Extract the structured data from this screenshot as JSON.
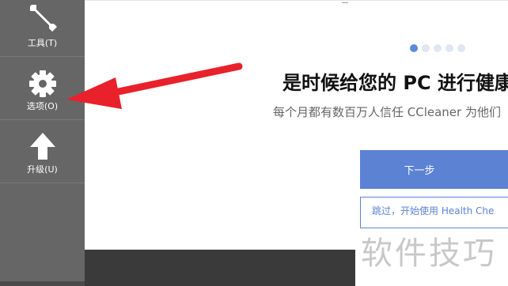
{
  "sidebar": {
    "items": [
      {
        "label": "工具(T)",
        "icon": "wrench-icon"
      },
      {
        "label": "选项(O)",
        "icon": "gear-icon"
      },
      {
        "label": "升级(U)",
        "icon": "up-arrow-icon"
      }
    ]
  },
  "onboarding": {
    "headline": "是时候给您的 PC 进行健康",
    "subtitle": "每个月都有数百万人信任 CCleaner 为他们",
    "next_label": "下一步",
    "skip_label": "跳过，开始使用 Health Che",
    "carousel": {
      "total": 5,
      "active": 1
    }
  },
  "annotation": {
    "arrow_color": "#e8212b",
    "points_to": "选项(O)"
  },
  "watermark": "软件技巧",
  "colors": {
    "sidebar_bg": "#666666",
    "accent": "#5b82d3",
    "arrow": "#e8212b"
  }
}
